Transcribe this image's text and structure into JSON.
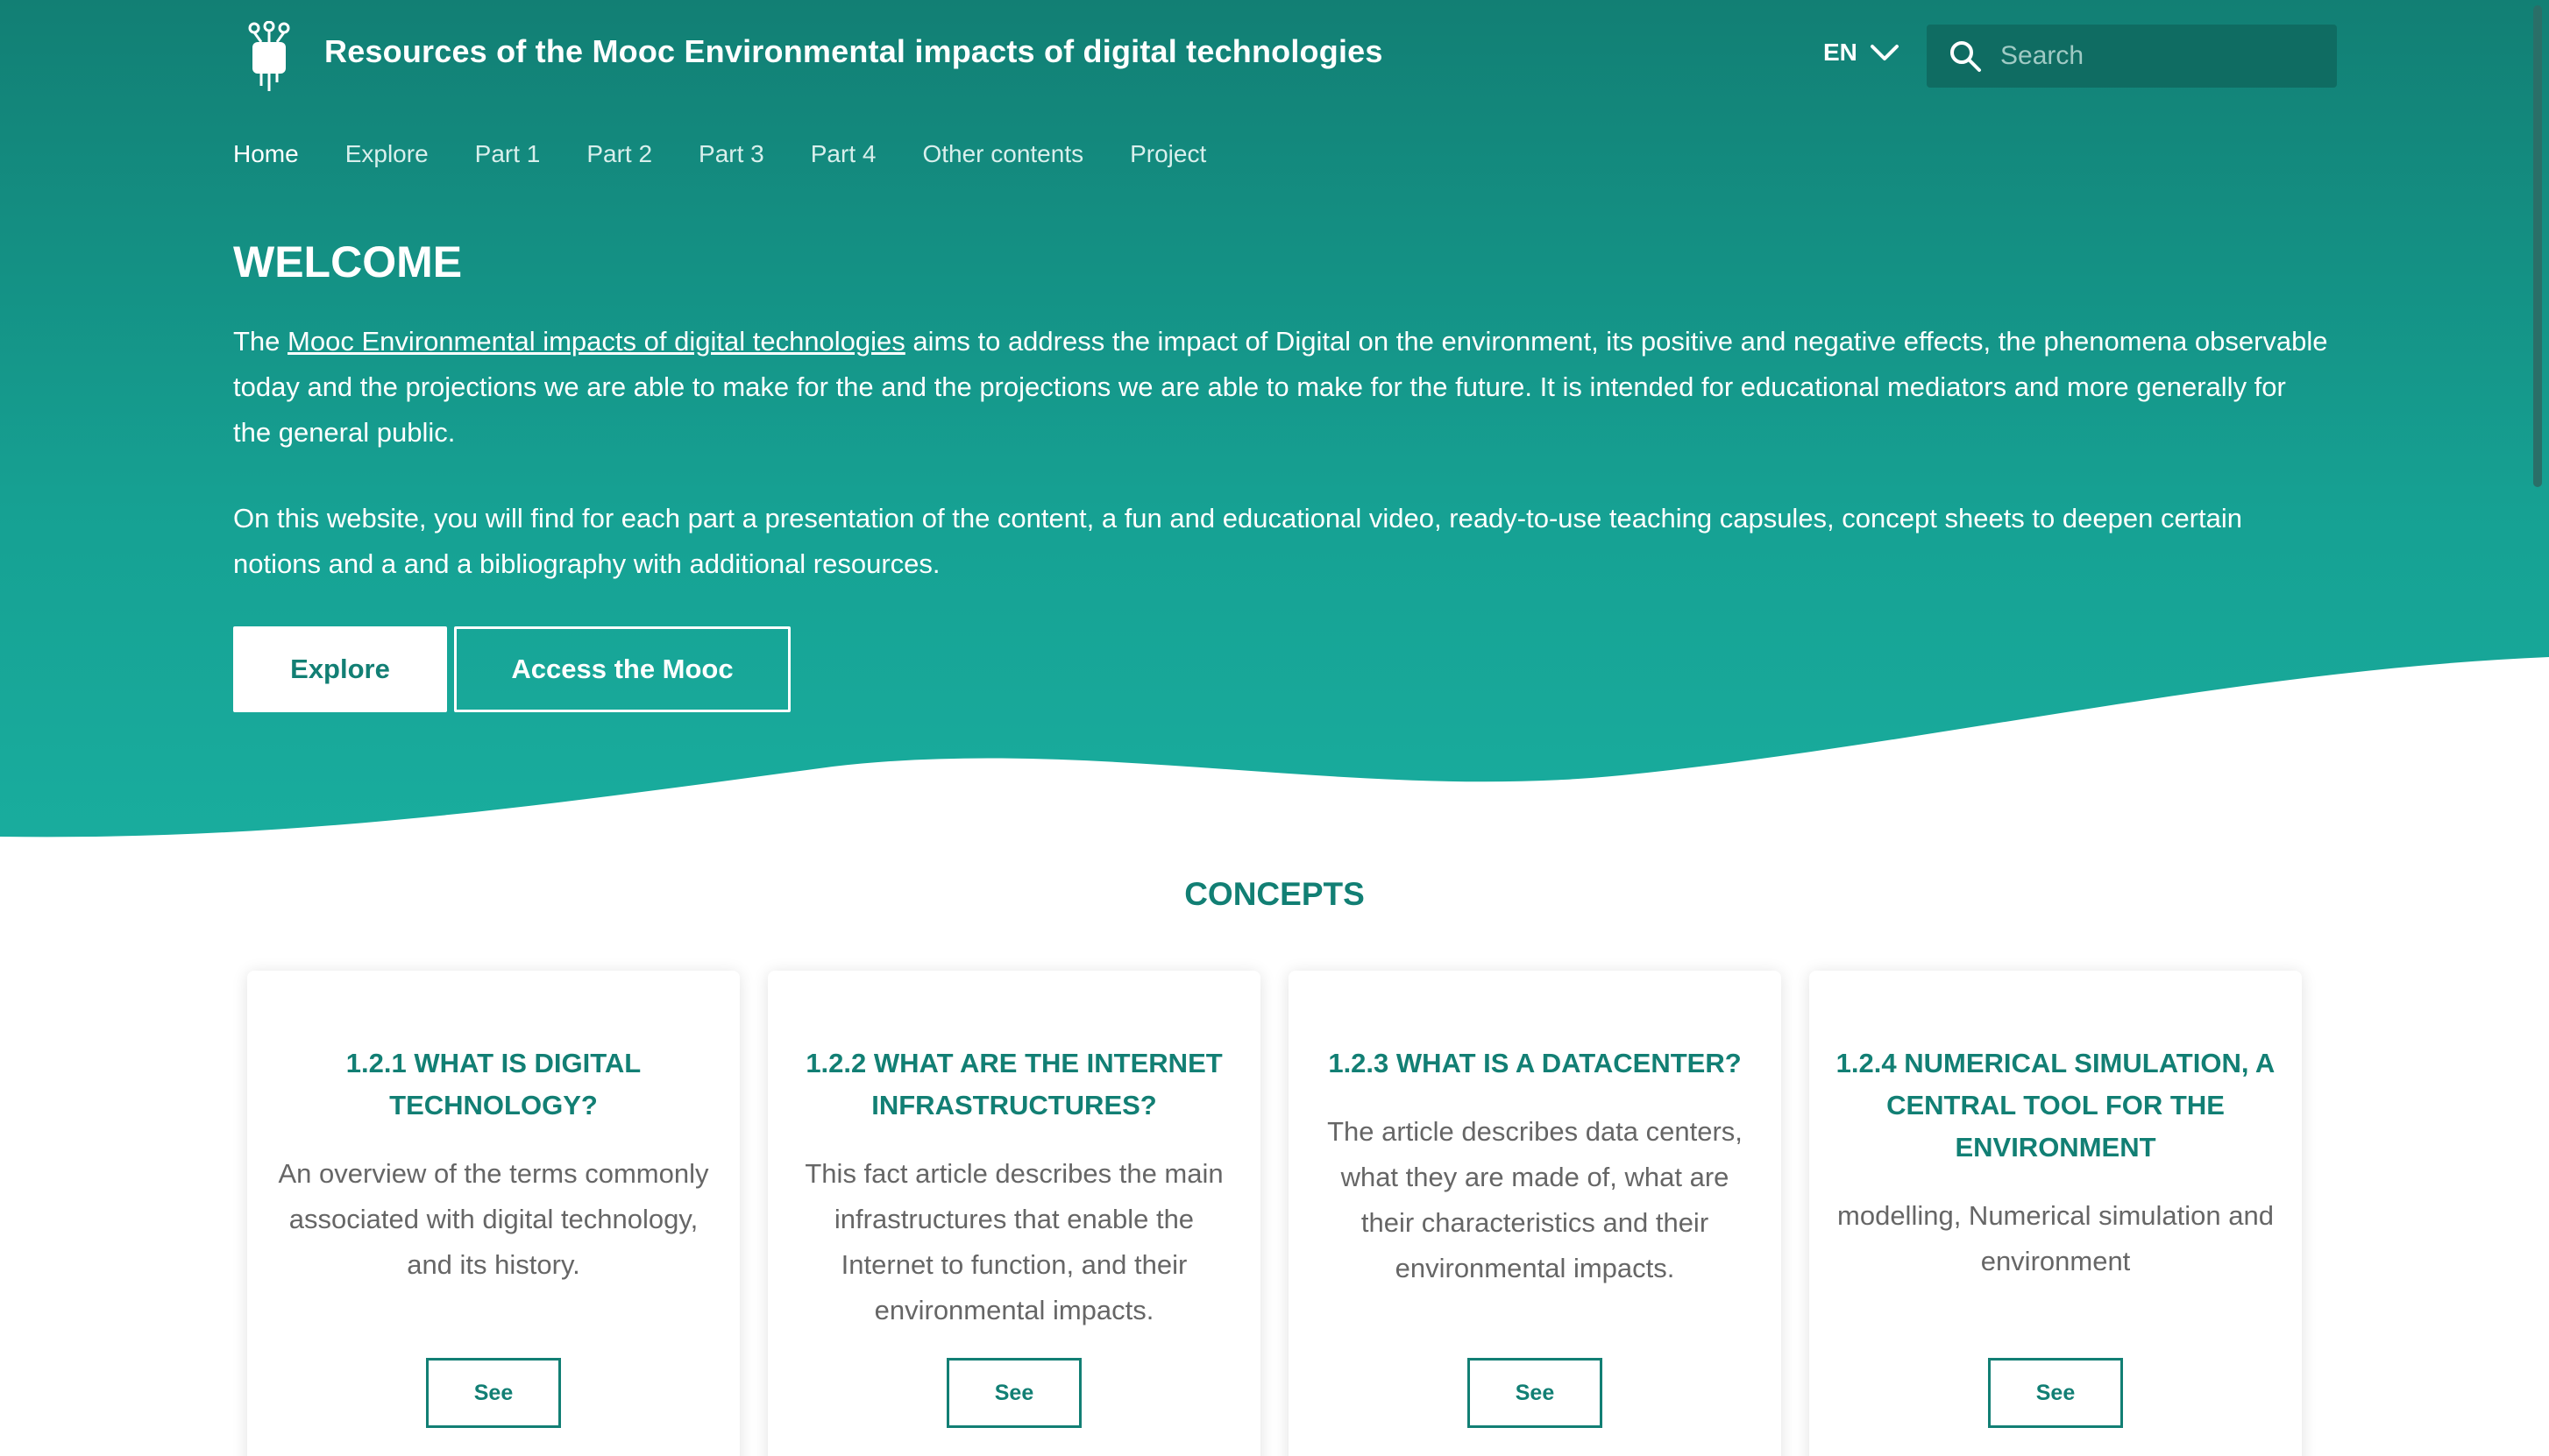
{
  "header": {
    "site_title": "Resources of the Mooc Environmental impacts of digital technologies",
    "language": "EN",
    "search_placeholder": "Search"
  },
  "nav": {
    "items": [
      "Home",
      "Explore",
      "Part 1",
      "Part 2",
      "Part 3",
      "Part 4",
      "Other contents",
      "Project"
    ],
    "active": "Home"
  },
  "hero": {
    "title": "WELCOME",
    "intro_prefix": "The ",
    "intro_link": "Mooc Environmental impacts of digital technologies",
    "intro_suffix": " aims to address the impact of Digital on the environment, its positive and negative effects, the phenomena observable today and the projections we are able to make for the and the projections we are able to make for the future. It is intended for educational mediators and more generally for the general public.",
    "paragraph2": "On this website, you will find for each part a presentation of the content, a fun and educational video, ready-to-use teaching capsules, concept sheets to deepen certain notions and a and a bibliography with additional resources.",
    "explore_button": "Explore",
    "mooc_button": "Access the Mooc"
  },
  "concepts": {
    "title": "CONCEPTS",
    "cards": [
      {
        "title": "1.2.1 WHAT IS DIGITAL TECHNOLOGY?",
        "description": "An overview of the terms commonly associated with digital technology, and its history.",
        "button": "See"
      },
      {
        "title": "1.2.2 WHAT ARE THE INTERNET INFRASTRUCTURES?",
        "description": "This fact article describes the main infrastructures that enable the Internet to function, and their environmental impacts.",
        "button": "See"
      },
      {
        "title": "1.2.3 WHAT IS A DATACENTER?",
        "description": "The article describes data centers, what they are made of, what are their characteristics and their environmental impacts.",
        "button": "See"
      },
      {
        "title": "1.2.4 NUMERICAL SIMULATION, A CENTRAL TOOL FOR THE ENVIRONMENT",
        "description": "modelling, Numerical simulation and environment",
        "button": "See"
      }
    ]
  },
  "colors": {
    "brand_dark": "#127f74",
    "brand_light": "#19ad9e",
    "search_bg": "#0f6c62",
    "text_muted": "#666666"
  },
  "icons": {
    "logo": "plug-logo-icon",
    "language": "chevron-down-icon",
    "search": "search-icon"
  }
}
